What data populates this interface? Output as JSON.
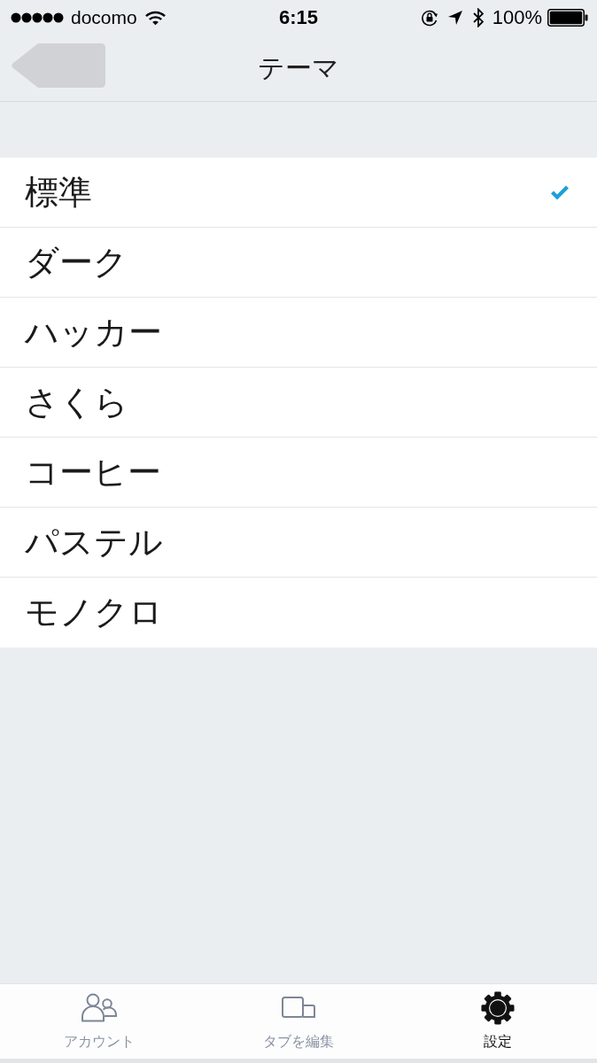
{
  "status_bar": {
    "carrier": "docomo",
    "time": "6:15",
    "battery": "100%"
  },
  "nav_bar": {
    "title": "テーマ"
  },
  "themes": [
    {
      "label": "標準",
      "selected": true
    },
    {
      "label": "ダーク",
      "selected": false
    },
    {
      "label": "ハッカー",
      "selected": false
    },
    {
      "label": "さくら",
      "selected": false
    },
    {
      "label": "コーヒー",
      "selected": false
    },
    {
      "label": "パステル",
      "selected": false
    },
    {
      "label": "モノクロ",
      "selected": false
    }
  ],
  "tab_bar": {
    "items": [
      {
        "label": "アカウント",
        "kind": "account",
        "selected": false
      },
      {
        "label": "タブを編集",
        "kind": "tabs",
        "selected": false
      },
      {
        "label": "設定",
        "kind": "settings",
        "selected": true
      }
    ]
  }
}
